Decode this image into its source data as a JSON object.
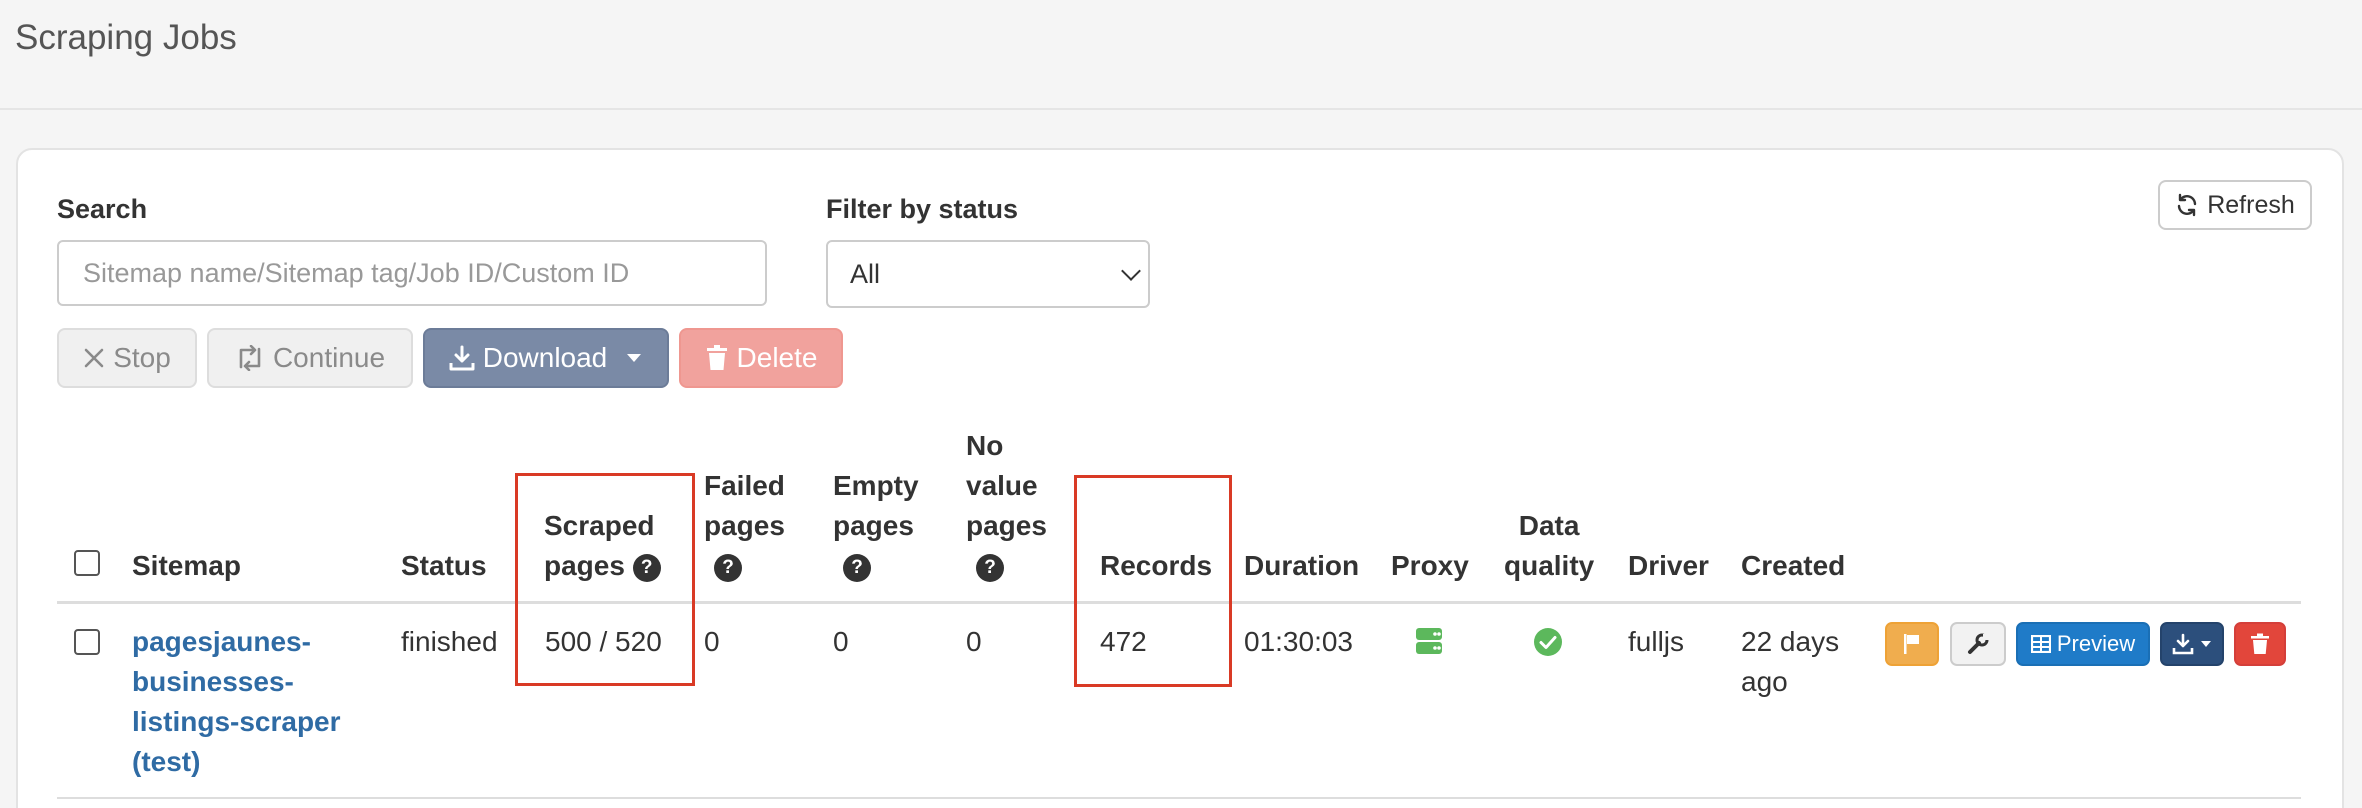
{
  "page": {
    "title": "Scraping Jobs"
  },
  "search": {
    "label": "Search",
    "placeholder": "Sitemap name/Sitemap tag/Job ID/Custom ID",
    "value": ""
  },
  "filter": {
    "label": "Filter by status",
    "selected": "All"
  },
  "toolbar": {
    "refresh_label": "Refresh",
    "stop_label": "Stop",
    "continue_label": "Continue",
    "download_label": "Download",
    "delete_label": "Delete"
  },
  "table": {
    "columns": {
      "sitemap": "Sitemap",
      "status": "Status",
      "scraped_pages_1": "Scraped",
      "scraped_pages_2": "pages",
      "failed_pages_1": "Failed",
      "failed_pages_2": "pages",
      "empty_pages_1": "Empty",
      "empty_pages_2": "pages",
      "no_value_pages_1": "No",
      "no_value_pages_2": "value",
      "no_value_pages_3": "pages",
      "records": "Records",
      "duration": "Duration",
      "proxy": "Proxy",
      "data_quality_1": "Data",
      "data_quality_2": "quality",
      "driver": "Driver",
      "created": "Created"
    },
    "help_glyph": "?",
    "rows": [
      {
        "sitemap_lines": [
          "pagesjaunes-",
          "businesses-",
          "listings-scraper",
          "(test)"
        ],
        "status": "finished",
        "scraped_pages": "500 / 520",
        "failed_pages": "0",
        "empty_pages": "0",
        "no_value_pages": "0",
        "records": "472",
        "duration": "01:30:03",
        "proxy_icon": "server-icon",
        "data_quality_icon": "check-circle-icon",
        "driver": "fulljs",
        "created_lines": [
          "22 days",
          "ago"
        ],
        "preview_label": "Preview"
      }
    ]
  },
  "colors": {
    "link": "#2f6ba4",
    "highlight": "#d93a25",
    "flag_button": "#f0ad4e",
    "preview_button": "#1f7bc8",
    "download_row_button": "#2c4f7c",
    "delete_row_button": "#e2463b",
    "ok_green": "#5cb85c"
  }
}
